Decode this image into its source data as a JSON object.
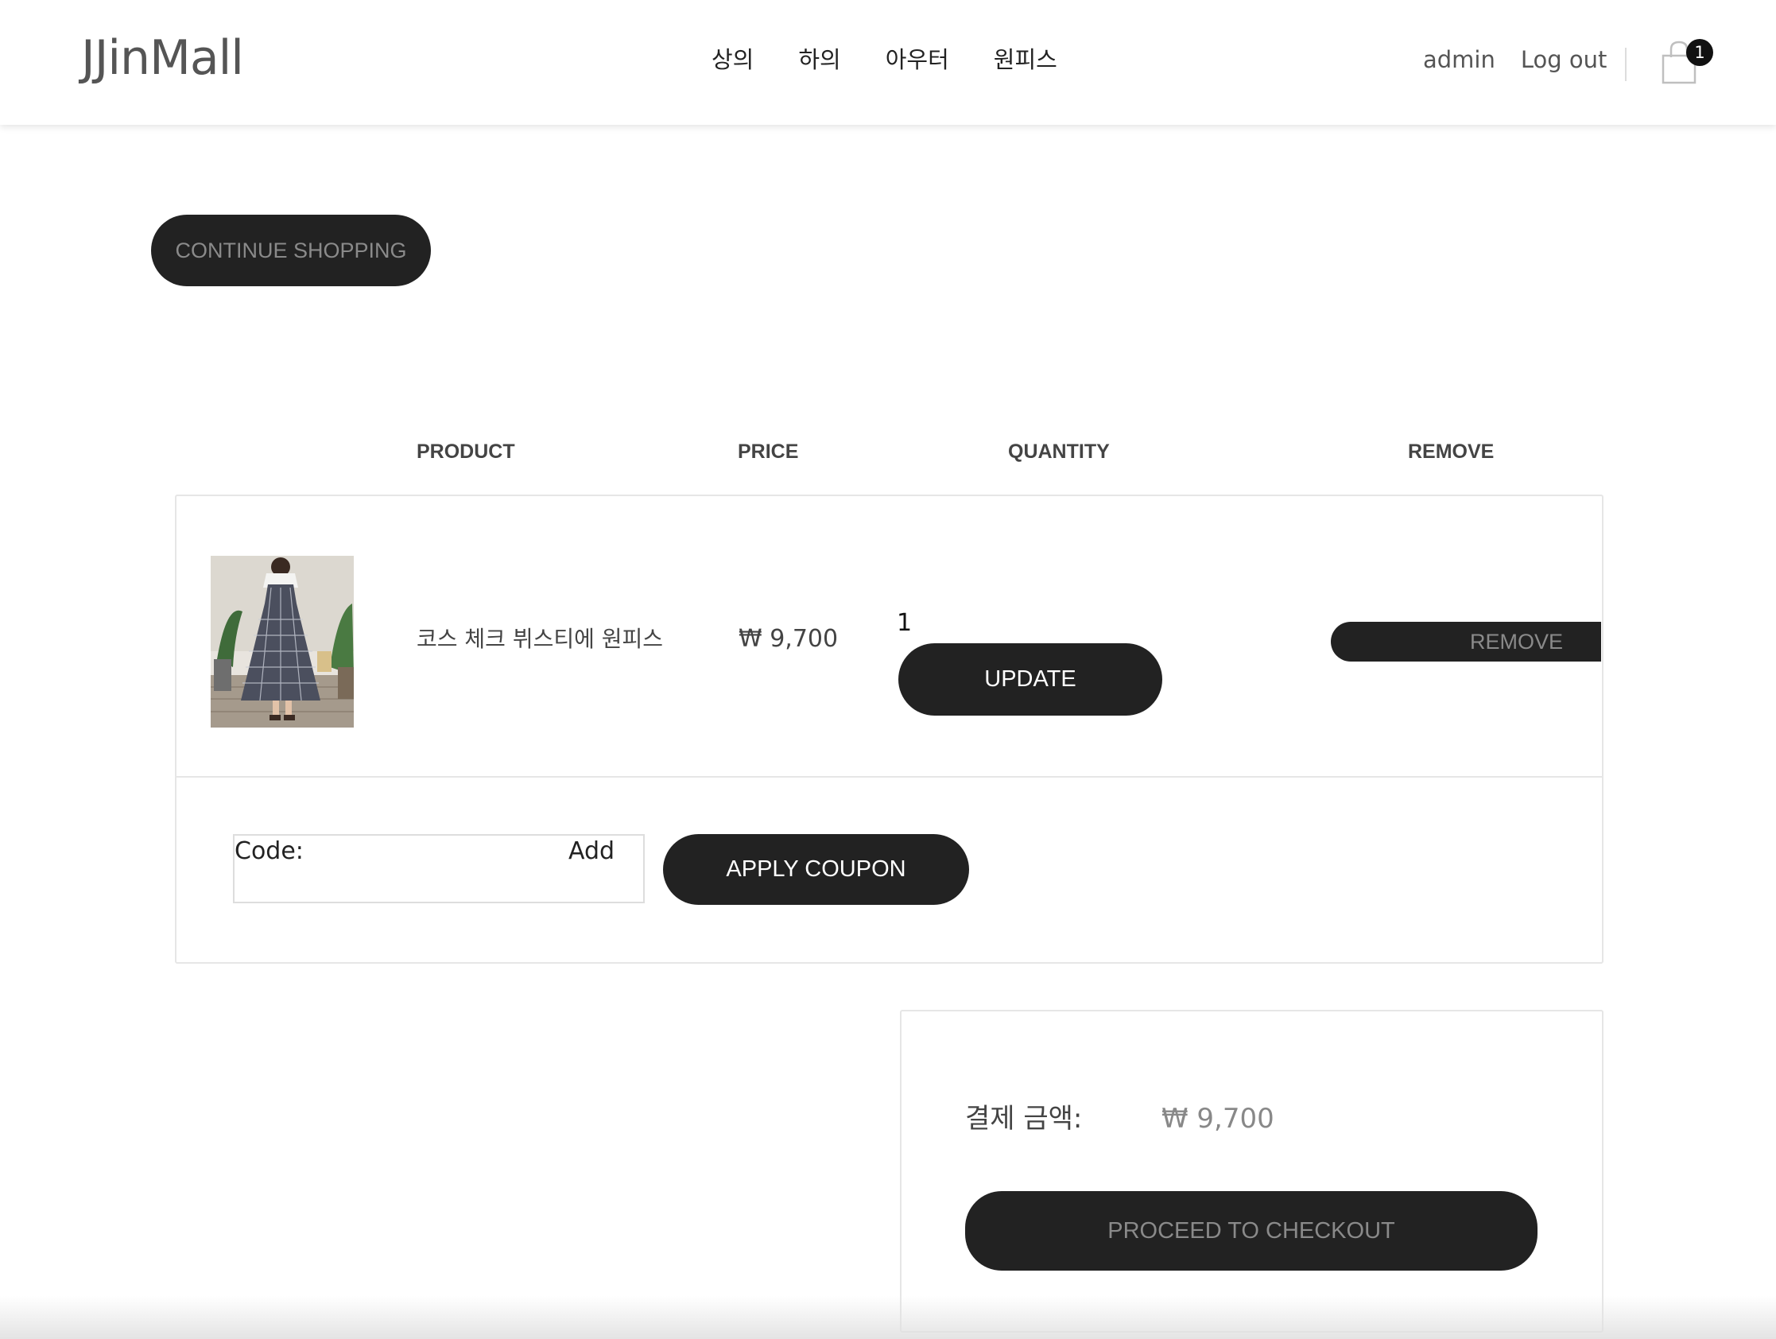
{
  "header": {
    "logo": "JJinMall",
    "nav": [
      "상의",
      "하의",
      "아우터",
      "원피스"
    ],
    "user": "admin",
    "logout": "Log out",
    "cart_count": "1"
  },
  "actions": {
    "continue_shopping": "CONTINUE SHOPPING"
  },
  "table": {
    "columns": [
      "PRODUCT",
      "PRICE",
      "QUANTITY",
      "REMOVE"
    ],
    "rows": [
      {
        "image": "checked-pinafore-dress-photo",
        "name": "코스 체크 뷔스티에 원피스",
        "price": "₩ 9,700",
        "quantity": "1",
        "update_label": "UPDATE",
        "remove_label": "REMOVE"
      }
    ]
  },
  "coupon": {
    "label": "Code:",
    "add": "Add",
    "apply_label": "APPLY COUPON"
  },
  "summary": {
    "label": "결제 금액:",
    "value": "₩ 9,700",
    "checkout_label": "PROCEED TO CHECKOUT"
  },
  "colors": {
    "button_bg": "#222222",
    "muted_text": "#8a8a8a",
    "border": "#e6e6e6"
  }
}
